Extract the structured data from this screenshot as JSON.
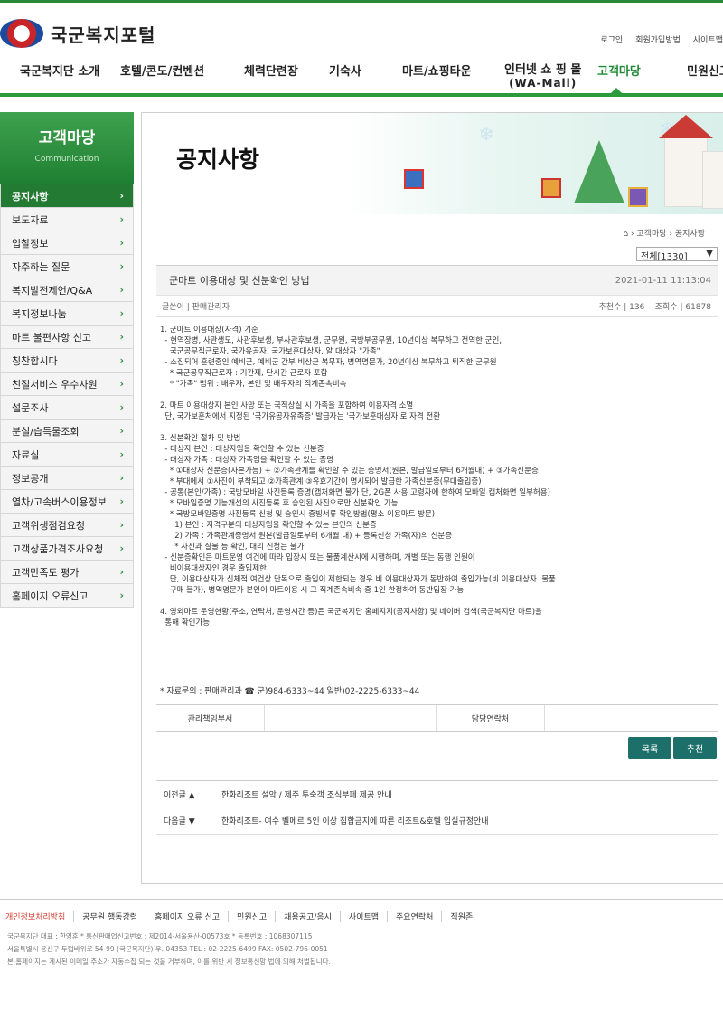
{
  "site": {
    "name": "국군복지포털"
  },
  "util": [
    "로그인",
    "회원가입방법",
    "사이트맵"
  ],
  "gnb": [
    {
      "label": "국군복지단 소개"
    },
    {
      "label": "호텔/콘도/컨벤션"
    },
    {
      "label": "체력단련장"
    },
    {
      "label": "기숙사"
    },
    {
      "label": "마트/쇼핑타운"
    },
    {
      "label": "인터넷 쇼 핑 몰",
      "sub": "(WA-Mall)"
    },
    {
      "label": "고객마당"
    },
    {
      "label": "민원신고"
    }
  ],
  "lnb": {
    "title": "고객마당",
    "subtitle": "Communication",
    "items": [
      "공지사항",
      "보도자료",
      "입찰정보",
      "자주하는 질문",
      "복지발전제언/Q&A",
      "복지정보나눔",
      "마트 불편사항 신고",
      "칭찬합시다",
      "친절서비스 우수사원",
      "설문조사",
      "분실/습득물조회",
      "자료실",
      "정보공개",
      "열차/고속버스이용정보",
      "고객위생점검요청",
      "고객상품가격조사요청",
      "고객만족도 평가",
      "홈페이지 오류신고"
    ]
  },
  "page": {
    "title": "공지사항",
    "breadcrumb": "› 고객마당 › 공지사항",
    "filter": "전체[1330]"
  },
  "post": {
    "title": "군마트 이용대상 및 신분확인 방법",
    "date": "2021-01-11 11:13:04",
    "author_label": "글쓴이 | 판매관리자",
    "recommend": "추천수 | 136",
    "views": "조회수 | 61878",
    "body": [
      "1. 군마트 이용대상(자격) 기준",
      "  - 현역장병, 사관생도, 사관후보생, 부사관후보생, 군무원, 국방부공무원, 10년이상 복무하고 전역한 군인,",
      "    국군공무직근로자, 국가유공자, 국가보훈대상자, 알 대상자 \"가족\"",
      "  - 소집되어 훈련중인 예비군, 예비군 간부 비상근 복무자, 병역명문가, 20년이상 복무하고 퇴직한 군무원",
      "    * 국군공무직근로자 : 기간제, 단시간 근로자 포함",
      "    * \"가족\" 범위 : 배우자, 본인 및 배우자의 직계존속비속",
      "",
      "2. 마트 이용대상자 본인 사망 또는 국적상실 시 가족을 포함하여 이용자격 소멸",
      "  단, 국가보훈처에서 지정된 '국가유공자유족증' 발급자는 '국가보훈대상자'로 자격 전환",
      "",
      "3. 신분확인 절차 및 방법",
      "  - 대상자 본인 : 대상자임을 확인할 수 있는 신분증",
      "  - 대상자 가족 : 대상자 가족임을 확인할 수 있는 증명",
      "    * ①대상자 신분증(사본가능) + ②가족관계를 확인할 수 있는 증명서(원본, 발급일로부터 6개월내) + ③가족신분증",
      "    * 부대에서 ①사진이 부착되고 ②가족관계 ③유효기간이 명시되어 발급한 가족신분증(무대출입증)",
      "  - 공통(본인/가족) : 국방모바일 사진등록 증명(캡처화면 불가 단, 2G폰 사용 고령자에 한하여 모바일 캡처화면 일부허용)",
      "    * 모바일증명 기능개선의 사진등록 후 승인된 사진으로만 신분확인 가능",
      "    * 국방모바일증명 사진등록 신청 및 승인시 증빙서류 확인방법(평소 이용마트 방문)",
      "      1) 본인 : 자격구분의 대상자임을 확인할 수 있는 본인의 신분증",
      "      2) 가족 : 가족관계증명서 원본(발급일로부터 6개월 내) + 등록신청 가족(자)의 신분증",
      "      * 사진과 실물 등 확인, 대리 신청은 불가",
      "  - 신분증확인은 마트운영 여건에 따라 입장시 또는 물품계산시에 시행하며, 개별 또는 동행 인원이",
      "    비이용대상자인 경우 출입제한",
      "    단, 이용대상자가 신체적 여건상 단독으로 출입이 제한되는 경우 비 이용대상자가 동반하여 출입가능(비 이용대상자  물품",
      "    구매 불가), 병역명문가 본인이 마트이용 시 그 직계존속비속 중 1인 한정하여 동반입장 가능",
      "",
      "4. 영외마트 운영현황(주소, 연락처, 운영시간 등)은 국군복지단 홈페지지(공지사항) 및 네이버 검색(국군복지단 마트)을",
      "  통해 확인가능"
    ],
    "contact": "* 자료문의 : 판매관리과 ☎ 군)984-6333~44   일반)02-2225-6333~44",
    "resp_label": "관리책임부서",
    "phone_label": "담당연락처"
  },
  "buttons": {
    "list": "목록",
    "recommend": "추천"
  },
  "nav": {
    "prev_label": "이전글 ▲",
    "prev_title": "한화리조트 설악 / 제주 투숙객 조식부페 제공 안내",
    "next_label": "다음글 ▼",
    "next_title": "한화리조트- 여수 벨메르 5인 이상 집합금지에 따른 리조트&호텔 입실규정안내"
  },
  "footer": {
    "links": [
      "개인정보처리방침",
      "공무원 행동강령",
      "홈페이지 오류 신고",
      "민원신고",
      "채용공고/응시",
      "사이트맵",
      "주요연락처",
      "직원존"
    ],
    "info": [
      "국군복지단 대표 : 한영훈 * 통신판매업신고번호 : 제2014-서울용산-00573호 * 등록번호 : 1068307115",
      "서울특별시 용산구 두텁바위로 54-99 (국군복지단) 우. 04353 TEL : 02-2225-6499 FAX: 0502-796-0051",
      "본 홈페이지는 게시된 이메일 주소가 자동수집 되는 것을 거부하며, 이를 위반 시 정보통신망 법에 의해 처벌됩니다."
    ]
  }
}
